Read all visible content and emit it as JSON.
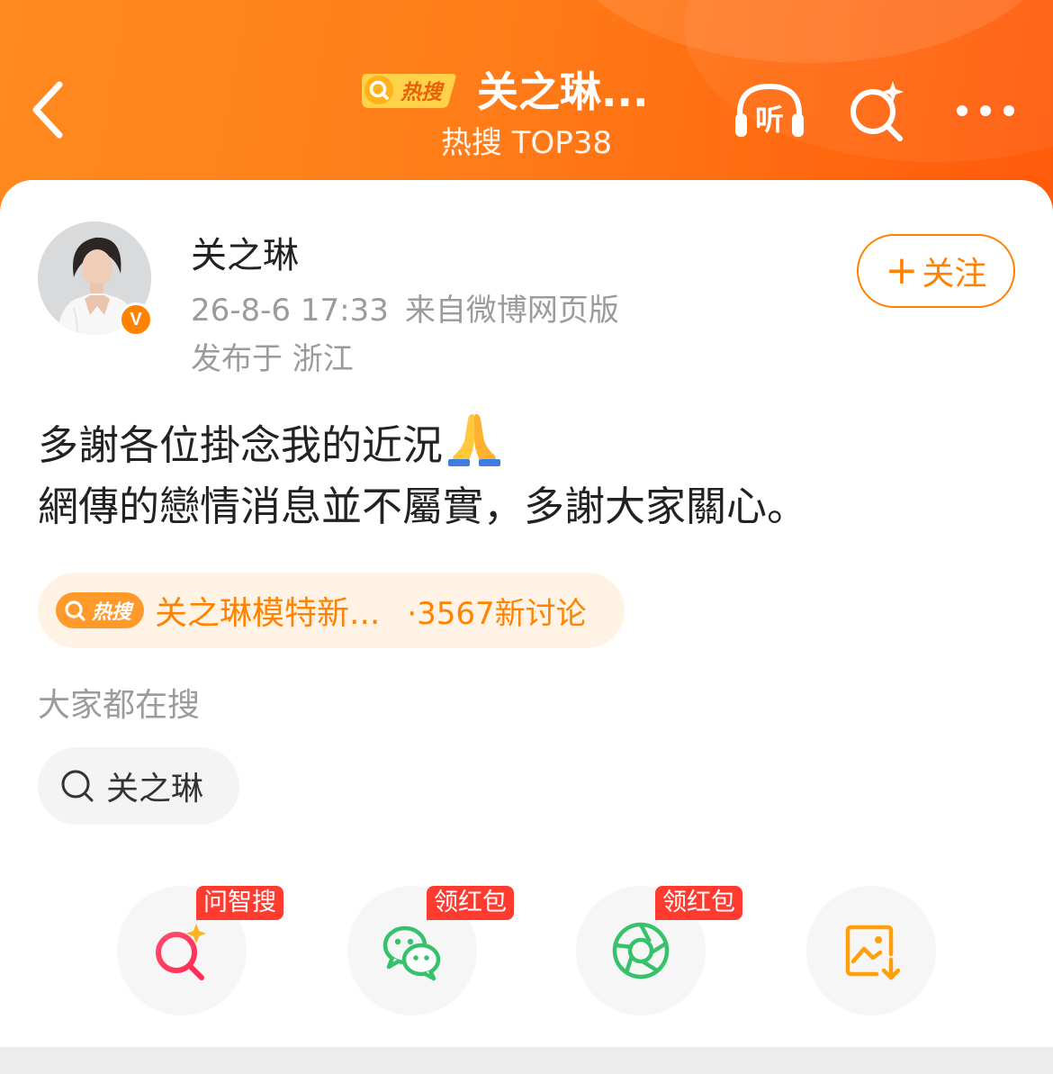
{
  "header": {
    "hot_badge_label": "热搜",
    "topic_title": "关之琳...",
    "rank_subtitle": "热搜 TOP38",
    "listen_label": "听"
  },
  "post": {
    "author_name": "关之琳",
    "timestamp": "26-8-6 17:33",
    "source": "来自微博网页版",
    "location": "发布于 浙江",
    "follow_label": "关注",
    "text_line1": "多謝各位掛念我的近況",
    "text_line2": "網傳的戀情消息並不屬實，多謝大家關心。",
    "verified_mark": "V"
  },
  "hot_topic": {
    "badge_label": "热搜",
    "title": "关之琳模特新...",
    "count": "·3567新讨论"
  },
  "related": {
    "section_label": "大家都在搜",
    "chips": [
      {
        "text": "关之琳"
      }
    ]
  },
  "actions": [
    {
      "icon": "ai-search-icon",
      "tag": "问智搜"
    },
    {
      "icon": "wechat-icon",
      "tag": "领红包"
    },
    {
      "icon": "moments-icon",
      "tag": "领红包"
    },
    {
      "icon": "save-image-icon",
      "tag": ""
    }
  ],
  "colors": {
    "brand_orange": "#ff8200",
    "header_start": "#ff8a1f",
    "header_end": "#ff5a0a",
    "tag_red": "#ff3b30",
    "wechat_green": "#36c16a"
  }
}
